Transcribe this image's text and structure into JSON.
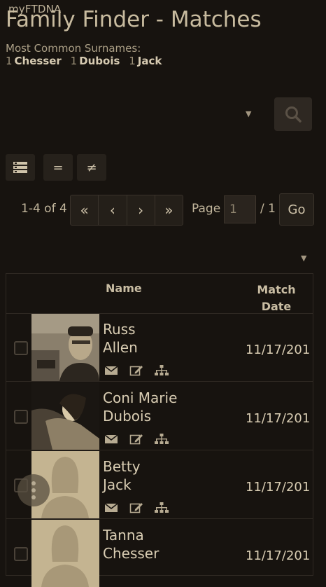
{
  "app": {
    "brand": "myFTDNA",
    "title": "Family Finder - Matches"
  },
  "surnames": {
    "label": "Most Common Surnames:",
    "items": [
      {
        "count": "1",
        "name": "Chesser"
      },
      {
        "count": "1",
        "name": "Dubois"
      },
      {
        "count": "1",
        "name": "Jack"
      }
    ]
  },
  "pager": {
    "range": "1-4 of 4",
    "first": "«",
    "prev": "‹",
    "next": "›",
    "last": "»",
    "page_label": "Page",
    "page_value": "1",
    "total": "/ 1",
    "go": "Go"
  },
  "view_buttons": [
    {
      "icon": "list-view-icon",
      "glyph": "≡"
    },
    {
      "icon": "equal-icon",
      "glyph": "="
    },
    {
      "icon": "not-equal-icon",
      "glyph": "≠"
    }
  ],
  "table": {
    "col_name": "Name",
    "col_date_line1": "Match",
    "col_date_line2": "Date",
    "rows": [
      {
        "first": "Russ",
        "last": "Allen",
        "date": "11/17/201",
        "photo": "photo"
      },
      {
        "first": "Coni Marie",
        "last": "Dubois",
        "date": "11/17/201",
        "photo": "photo"
      },
      {
        "first": "Betty",
        "last": "Jack",
        "date": "11/17/201",
        "photo": "silhouette"
      },
      {
        "first": "Tanna",
        "last": "Chesser",
        "date": "11/17/201",
        "photo": "silhouette"
      }
    ]
  },
  "row_icons": [
    "email-icon",
    "edit-note-icon",
    "family-tree-icon"
  ],
  "colors": {
    "background": "#17130f",
    "text": "#d9cdb3",
    "accent": "#c8bb9f"
  }
}
